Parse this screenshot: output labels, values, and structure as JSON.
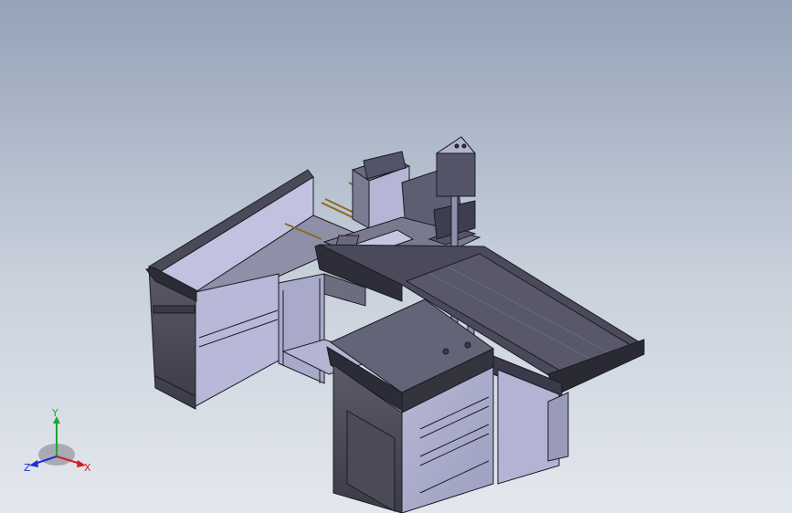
{
  "view": {
    "background_top": "#95a3b8",
    "background_bottom": "#e4e8ee",
    "model_fill": "#a7a9c7",
    "model_fill_light": "#c4c4e0",
    "model_dark": "#3a3a4a",
    "edge_color": "#1b1b24"
  },
  "triad": {
    "x_label": "X",
    "y_label": "Y",
    "z_label": "Z",
    "x_color": "#d21e1e",
    "y_color": "#1fa531",
    "z_color": "#1f2bd6"
  }
}
